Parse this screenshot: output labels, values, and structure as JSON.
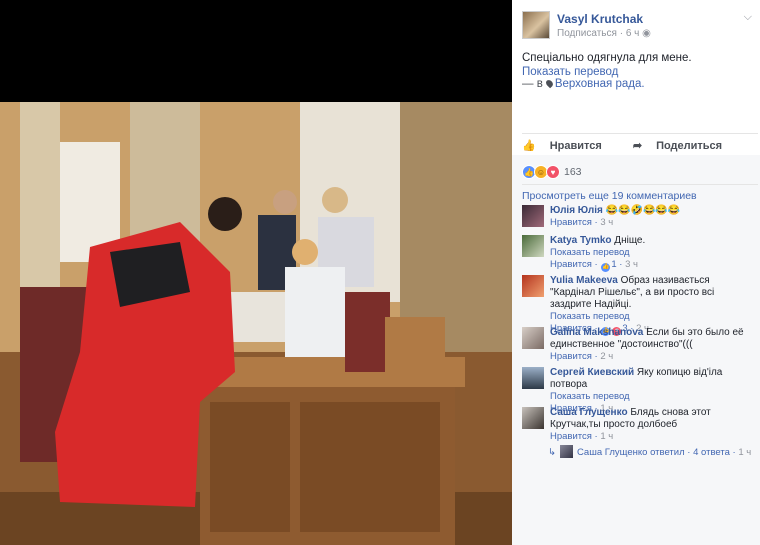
{
  "post": {
    "author": "Vasyl Krutchak",
    "subscribe": "Подписаться",
    "time": "6 ч",
    "text": "Спеціально одягнула для мене.",
    "translate": "Показать перевод",
    "location_prefix": "— в",
    "location": "Верховная рада."
  },
  "actions": {
    "like": "Нравится",
    "share": "Поделиться"
  },
  "reactions": {
    "count": "163"
  },
  "more_comments": "Просмотреть еще 19 комментариев",
  "comments": [
    {
      "name": "Юлія Юлія",
      "text": "😂😂🤣😂😂😂",
      "like": "Нравится",
      "time": "3 ч"
    },
    {
      "name": "Katya Tymko",
      "text": "Дніще.",
      "translate": "Показать перевод",
      "like": "Нравится",
      "likes": "1",
      "time": "3 ч"
    },
    {
      "name": "Yulia Makeeva",
      "text": "Образ називається \"Кардінал Рішельє\", а ви просто всі заздрите Надійці.",
      "translate": "Показать перевод",
      "like": "Нравится",
      "likes": "3",
      "time": "2 ч"
    },
    {
      "name": "Galina Makshanova",
      "text": "Если бы это было её единственное \"достоинство\"(((",
      "like": "Нравится",
      "time": "2 ч"
    },
    {
      "name": "Сергей Киевский",
      "text": "Яку копицю від'іла потвора",
      "translate": "Показать перевод",
      "like": "Нравится",
      "time": "1 ч"
    },
    {
      "name": "Саша Глущенко",
      "text": "Блядь снова этот Крутчак,ты просто долбоеб",
      "like": "Нравится",
      "time": "1 ч"
    }
  ],
  "reply": {
    "author": "Саша Глущенко ответил",
    "count": "4 ответа",
    "time": "1 ч"
  }
}
